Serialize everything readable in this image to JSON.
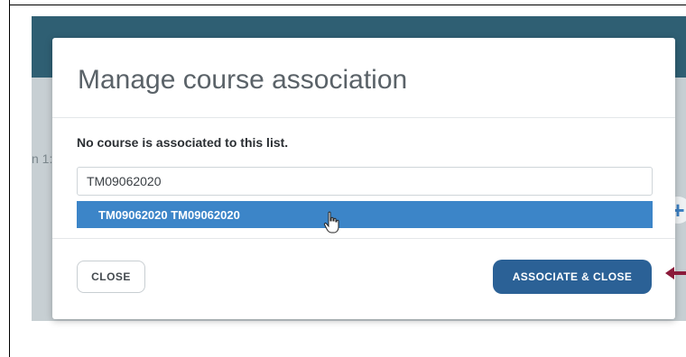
{
  "dialog": {
    "title": "Manage course association",
    "status_text": "No course is associated to this list.",
    "search_value": "TM09062020",
    "suggestion": "TM09062020 TM09062020",
    "close_label": "CLOSE",
    "associate_label": "ASSOCIATE & CLOSE"
  },
  "background": {
    "partial_text": "n 1:",
    "plus_glyph": "+"
  },
  "colors": {
    "header": "#2f5f73",
    "primary_button": "#2b6196",
    "dropdown_highlight": "#3c85c8",
    "annotation_arrow": "#8b1a3a"
  },
  "icons": {
    "pointer": "hand-pointer-icon",
    "annotation": "arrow-left-icon"
  }
}
